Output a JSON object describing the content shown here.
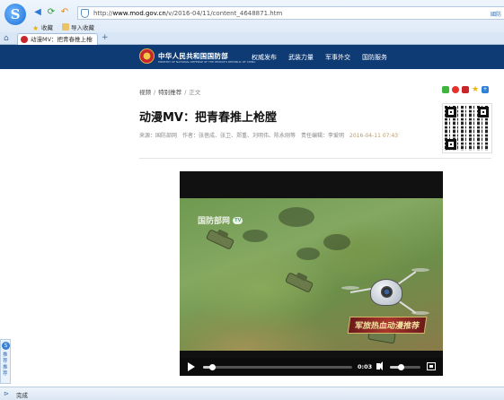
{
  "browser": {
    "logo_glyph": "S",
    "url_prefix": "http://",
    "url_domain": "www.mod.gov.cn",
    "url_path": "/v/2016-04/11/content_4648871.htm",
    "address_right": "國防",
    "favorites": [
      {
        "label": "收藏",
        "icon": "star-icon"
      },
      {
        "label": "导入收藏",
        "icon": "folder-icon"
      }
    ],
    "tab_title": "动漫MV：把青春推上枪",
    "tab_close": "×",
    "new_tab": "+"
  },
  "site": {
    "name": "中华人民共和国国防部",
    "name_en": "MINISTRY OF NATIONAL DEFENSE OF THE PEOPLE'S REPUBLIC OF CHINA",
    "nav": [
      "权威发布",
      "武装力量",
      "军事外交",
      "国防服务"
    ]
  },
  "article": {
    "breadcrumb": [
      "视频",
      "特别推荐",
      "正文"
    ],
    "title": "动漫MV：把青春推上枪膛",
    "source_label": "来源：国防部网",
    "author_label": "作者：张蓓成、张卫、郑重、刘明伟、陈永刚等",
    "editor_label": "责任编辑：李爱明",
    "date": "2016-04-11 07:43"
  },
  "share_icons": [
    "wechat-icon",
    "weibo-icon",
    "renren-icon",
    "qzone-icon",
    "more-share-icon"
  ],
  "player": {
    "watermark": "国防部网",
    "watermark_badge": "TV",
    "caption": "军旅热血动漫推荐",
    "current_time": "0:03",
    "progress": 0.06,
    "volume": 0.35
  },
  "side_widget": {
    "text": "推荐 推荐"
  },
  "status": {
    "text": "完成"
  },
  "colors": {
    "header_bg": "#0f3b75",
    "date": "#b99a6a",
    "player_bg": "#111111"
  }
}
